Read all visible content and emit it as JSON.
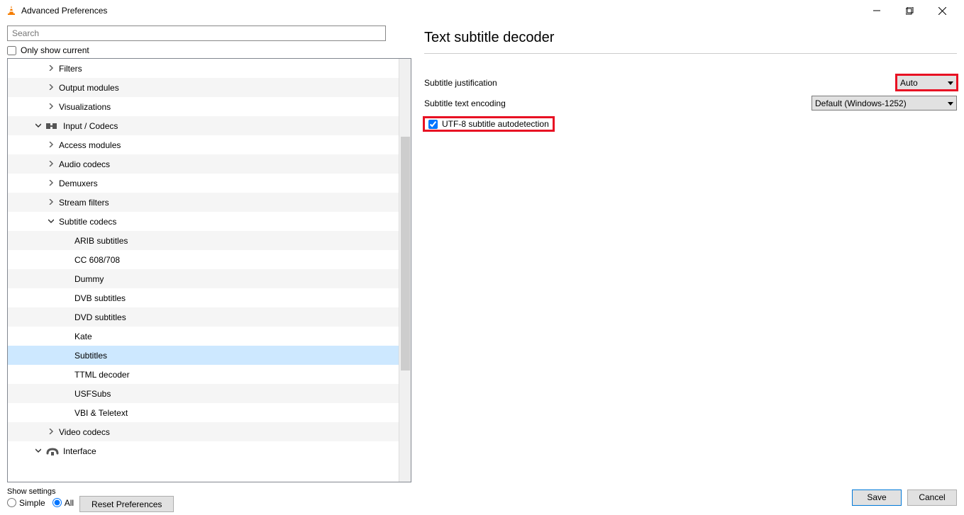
{
  "window": {
    "title": "Advanced Preferences"
  },
  "left": {
    "search_placeholder": "Search",
    "only_current": "Only show current",
    "tree": [
      {
        "indent": 1,
        "exp": ">",
        "label": "Filters"
      },
      {
        "indent": 1,
        "exp": ">",
        "label": "Output modules"
      },
      {
        "indent": 1,
        "exp": ">",
        "label": "Visualizations"
      },
      {
        "indent": 0,
        "exp": "v",
        "label": "Input / Codecs",
        "icon": "io"
      },
      {
        "indent": 1,
        "exp": ">",
        "label": "Access modules"
      },
      {
        "indent": 1,
        "exp": ">",
        "label": "Audio codecs"
      },
      {
        "indent": 1,
        "exp": ">",
        "label": "Demuxers"
      },
      {
        "indent": 1,
        "exp": ">",
        "label": "Stream filters"
      },
      {
        "indent": 1,
        "exp": "v",
        "label": "Subtitle codecs"
      },
      {
        "indent": 2,
        "exp": "",
        "label": "ARIB subtitles"
      },
      {
        "indent": 2,
        "exp": "",
        "label": "CC 608/708"
      },
      {
        "indent": 2,
        "exp": "",
        "label": "Dummy"
      },
      {
        "indent": 2,
        "exp": "",
        "label": "DVB subtitles"
      },
      {
        "indent": 2,
        "exp": "",
        "label": "DVD subtitles"
      },
      {
        "indent": 2,
        "exp": "",
        "label": "Kate"
      },
      {
        "indent": 2,
        "exp": "",
        "label": "Subtitles",
        "selected": true
      },
      {
        "indent": 2,
        "exp": "",
        "label": "TTML decoder"
      },
      {
        "indent": 2,
        "exp": "",
        "label": "USFSubs"
      },
      {
        "indent": 2,
        "exp": "",
        "label": "VBI & Teletext"
      },
      {
        "indent": 1,
        "exp": ">",
        "label": "Video codecs"
      },
      {
        "indent": 0,
        "exp": "v",
        "label": "Interface",
        "icon": "iface"
      }
    ]
  },
  "right": {
    "heading": "Text subtitle decoder",
    "rows": {
      "justification": {
        "label": "Subtitle justification",
        "value": "Auto"
      },
      "encoding": {
        "label": "Subtitle text encoding",
        "value": "Default (Windows-1252)"
      },
      "utf8": {
        "label": "UTF-8 subtitle autodetection",
        "checked": true
      }
    }
  },
  "footer": {
    "show_settings": "Show settings",
    "simple": "Simple",
    "all": "All",
    "reset": "Reset Preferences",
    "save": "Save",
    "cancel": "Cancel"
  }
}
